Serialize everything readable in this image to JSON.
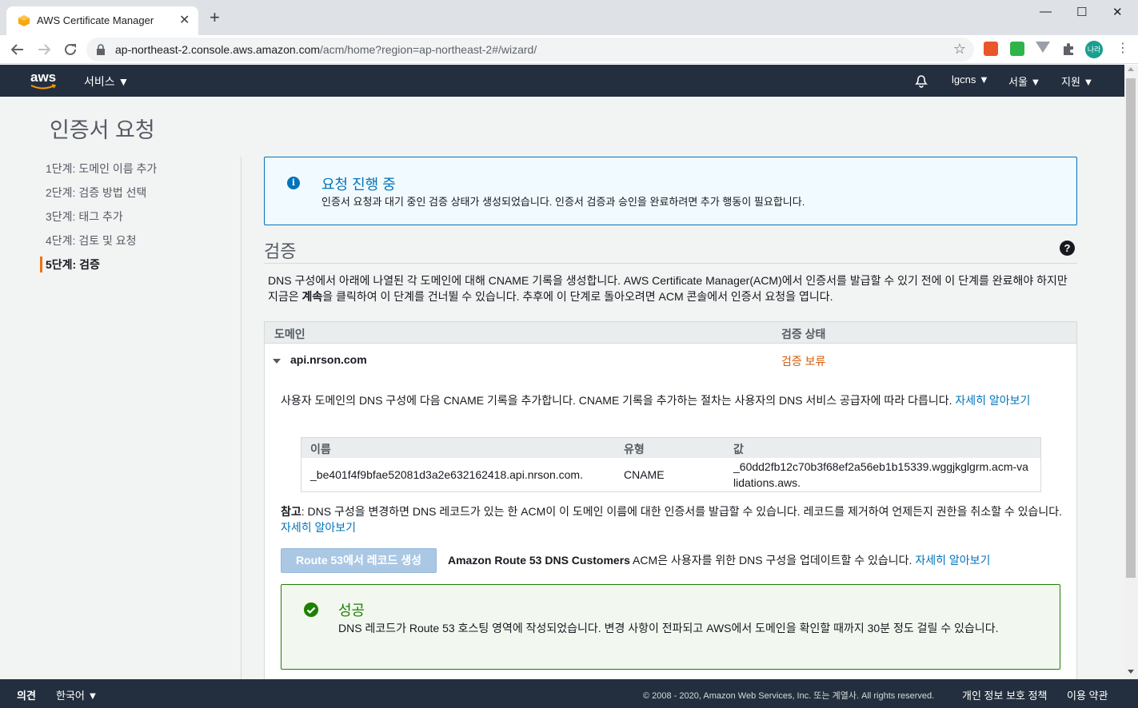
{
  "browser": {
    "tab_title": "AWS Certificate Manager",
    "tab_close": "✕",
    "new_tab": "+",
    "url_host": "ap-northeast-2.console.aws.amazon.com",
    "url_path": "/acm/home?region=ap-northeast-2#/wizard/",
    "profile_initials": "나라",
    "window_controls": {
      "minimize": "—",
      "maximize": "☐",
      "close": "✕"
    }
  },
  "aws_header": {
    "logo": "aws",
    "services_label": "서비스 ▼",
    "account_label": "lgcns ▼",
    "region_label": "서울 ▼",
    "support_label": "지원 ▼"
  },
  "page": {
    "title": "인증서 요청",
    "steps": [
      {
        "label": "1단계: 도메인 이름 추가",
        "active": false
      },
      {
        "label": "2단계: 검증 방법 선택",
        "active": false
      },
      {
        "label": "3단계: 태그 추가",
        "active": false
      },
      {
        "label": "4단계: 검토 및 요청",
        "active": false
      },
      {
        "label": "5단계: 검증",
        "active": true
      }
    ]
  },
  "info_alert": {
    "icon": "info-icon",
    "title": "요청 진행 중",
    "text": "인증서 요청과 대기 중인 검증 상태가 생성되었습니다. 인증서 검증과 승인을 완료하려면 추가 행동이 필요합니다."
  },
  "validation": {
    "title": "검증",
    "description_part1": "DNS 구성에서 아래에 나열된 각 도메인에 대해 CNAME 기록을 생성합니다. AWS Certificate Manager(ACM)에서 인증서를 발급할 수 있기 전에 이 단계를 완료해야 하지만 지금은 ",
    "description_bold": "계속",
    "description_part2": "을 클릭하여 이 단계를 건너뛸 수 있습니다. 추후에 이 단계로 돌아오려면 ACM 콘솔에서 인증서 요청을 엽니다.",
    "table": {
      "col_domain": "도메인",
      "col_status": "검증 상태",
      "domain": "api.nrson.com",
      "status": "검증 보류"
    },
    "cname_desc": "사용자 도메인의 DNS 구성에 다음 CNAME 기록을 추가합니다. CNAME 기록을 추가하는 절차는 사용자의 DNS 서비스 공급자에 따라 다릅니다. ",
    "learn_more": "자세히 알아보기",
    "cname_table": {
      "col_name": "이름",
      "col_type": "유형",
      "col_value": "값",
      "name": "_be401f4f9bfae52081d3a2e632162418.api.nrson.com.",
      "type": "CNAME",
      "value": "_60dd2fb12c70b3f68ef2a56eb1b15339.wggjkglgrm.acm-validations.aws."
    },
    "note_label": "참고",
    "note_text": ": DNS 구성을 변경하면 DNS 레코드가 있는 한 ACM이 이 도메인 이름에 대한 인증서를 발급할 수 있습니다. 레코드를 제거하여 언제든지 권한을 취소할 수 있습니다. ",
    "route53_button": "Route 53에서 레코드 생성",
    "route53_bold": "Amazon Route 53 DNS Customers",
    "route53_text": " ACM은 사용자를 위한 DNS 구성을 업데이트할 수 있습니다. ",
    "success_title": "성공",
    "success_text": "DNS 레코드가 Route 53 호스팅 영역에 작성되었습니다. 변경 사항이 전파되고 AWS에서 도메인을 확인할 때까지 30분 정도 걸릴 수 있습니다."
  },
  "footer": {
    "feedback": "의견",
    "language": "한국어 ▼",
    "copyright": "© 2008 - 2020, Amazon Web Services, Inc. 또는 계열사. All rights reserved.",
    "privacy": "개인 정보 보호 정책",
    "terms": "이용 약관"
  },
  "colors": {
    "aws_nav": "#232f3e",
    "info_blue": "#0073bb",
    "pending_orange": "#d45b07",
    "success_green": "#1d8102"
  }
}
